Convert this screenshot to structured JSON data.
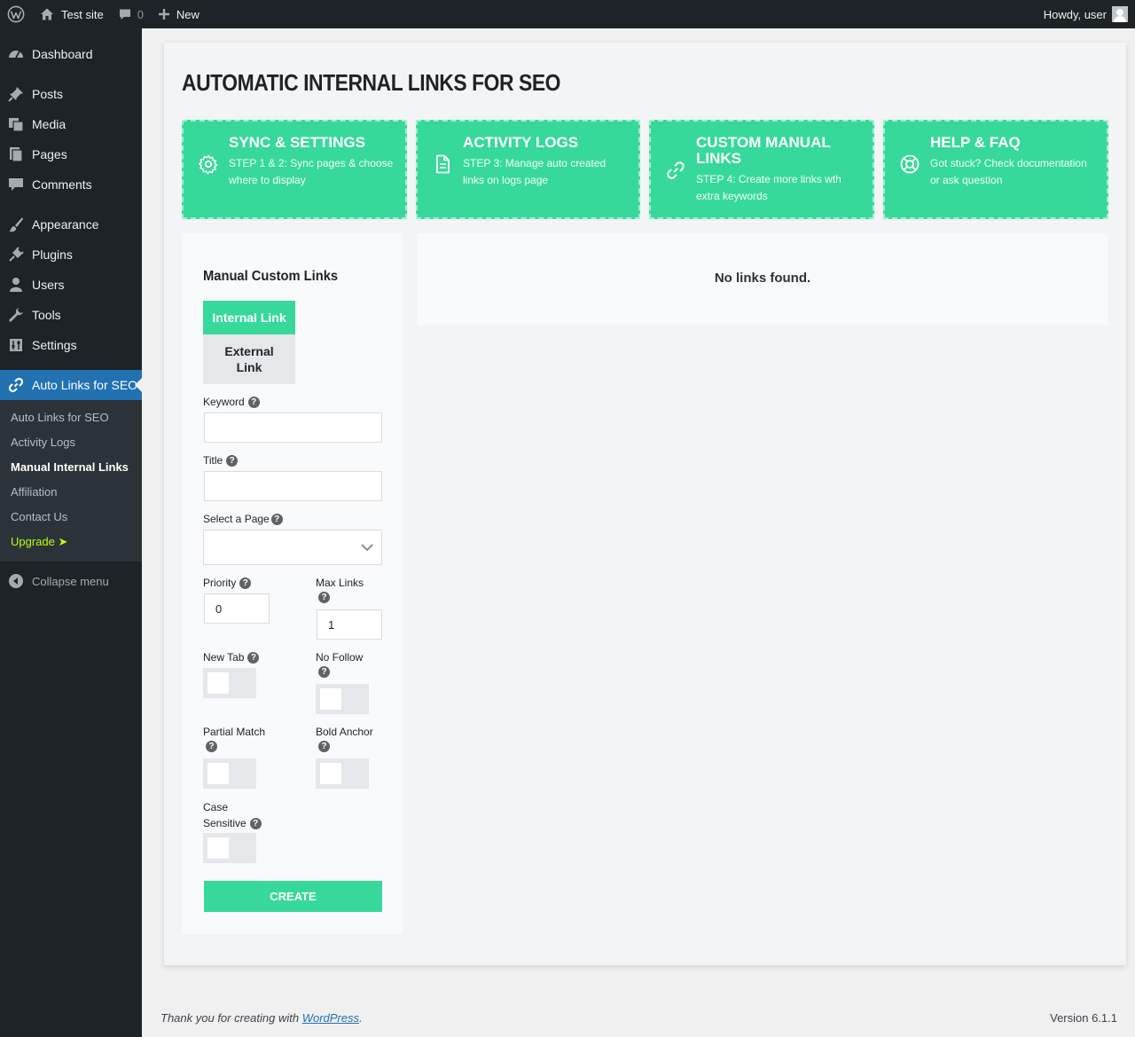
{
  "admin_bar": {
    "site_name": "Test site",
    "comments_count": "0",
    "new_label": "New",
    "howdy": "Howdy, user"
  },
  "sidebar": {
    "items": [
      {
        "label": "Dashboard",
        "icon": "dashboard-icon"
      },
      {
        "label": "Posts",
        "icon": "pin-icon"
      },
      {
        "label": "Media",
        "icon": "media-icon"
      },
      {
        "label": "Pages",
        "icon": "pages-icon"
      },
      {
        "label": "Comments",
        "icon": "comment-icon"
      },
      {
        "label": "Appearance",
        "icon": "brush-icon"
      },
      {
        "label": "Plugins",
        "icon": "plug-icon"
      },
      {
        "label": "Users",
        "icon": "user-icon"
      },
      {
        "label": "Tools",
        "icon": "wrench-icon"
      },
      {
        "label": "Settings",
        "icon": "settings-icon"
      },
      {
        "label": "Auto Links for SEO",
        "icon": "link-icon"
      }
    ],
    "submenu": [
      {
        "label": "Auto Links for SEO"
      },
      {
        "label": "Activity Logs"
      },
      {
        "label": "Manual Internal Links"
      },
      {
        "label": "Affiliation"
      },
      {
        "label": "Contact Us"
      },
      {
        "label": "Upgrade ➤"
      }
    ],
    "collapse_label": "Collapse menu"
  },
  "page": {
    "title": "AUTOMATIC INTERNAL LINKS FOR SEO"
  },
  "cards": [
    {
      "title": "SYNC & SETTINGS",
      "text": "STEP 1 & 2: Sync pages & choose where to display",
      "icon": "gear-icon"
    },
    {
      "title": "ACTIVITY LOGS",
      "text": "STEP 3: Manage auto created links on logs page",
      "icon": "document-icon"
    },
    {
      "title": "CUSTOM MANUAL LINKS",
      "text": "STEP 4: Create more links wth extra keywords",
      "icon": "link-icon"
    },
    {
      "title": "HELP & FAQ",
      "text": "Got stuck? Check documentation or ask question",
      "icon": "lifebuoy-icon"
    }
  ],
  "form": {
    "heading": "Manual Custom Links",
    "tabs": {
      "internal": "Internal Link",
      "external": "External Link"
    },
    "keyword_label": "Keyword",
    "keyword_value": "",
    "title_label": "Title",
    "title_value": "",
    "page_label": "Select a Page",
    "priority_label": "Priority",
    "priority_value": "0",
    "max_links_label": "Max Links",
    "max_links_value": "1",
    "new_tab_label": "New Tab",
    "no_follow_label": "No Follow",
    "partial_match_label": "Partial Match",
    "bold_anchor_label": "Bold Anchor",
    "case_sensitive_label": "Case Sensitive",
    "create_label": "CREATE",
    "help_glyph": "?"
  },
  "results": {
    "empty_text": "No links found."
  },
  "footer": {
    "thanks_prefix": "Thank you for creating with ",
    "wp_link": "WordPress",
    "thanks_suffix": ".",
    "version": "Version 6.1.1"
  },
  "colors": {
    "accent_green": "#37d99b",
    "wp_blue": "#2271b1",
    "admin_dark": "#1d2327",
    "upgrade_green": "#b8ff12"
  }
}
